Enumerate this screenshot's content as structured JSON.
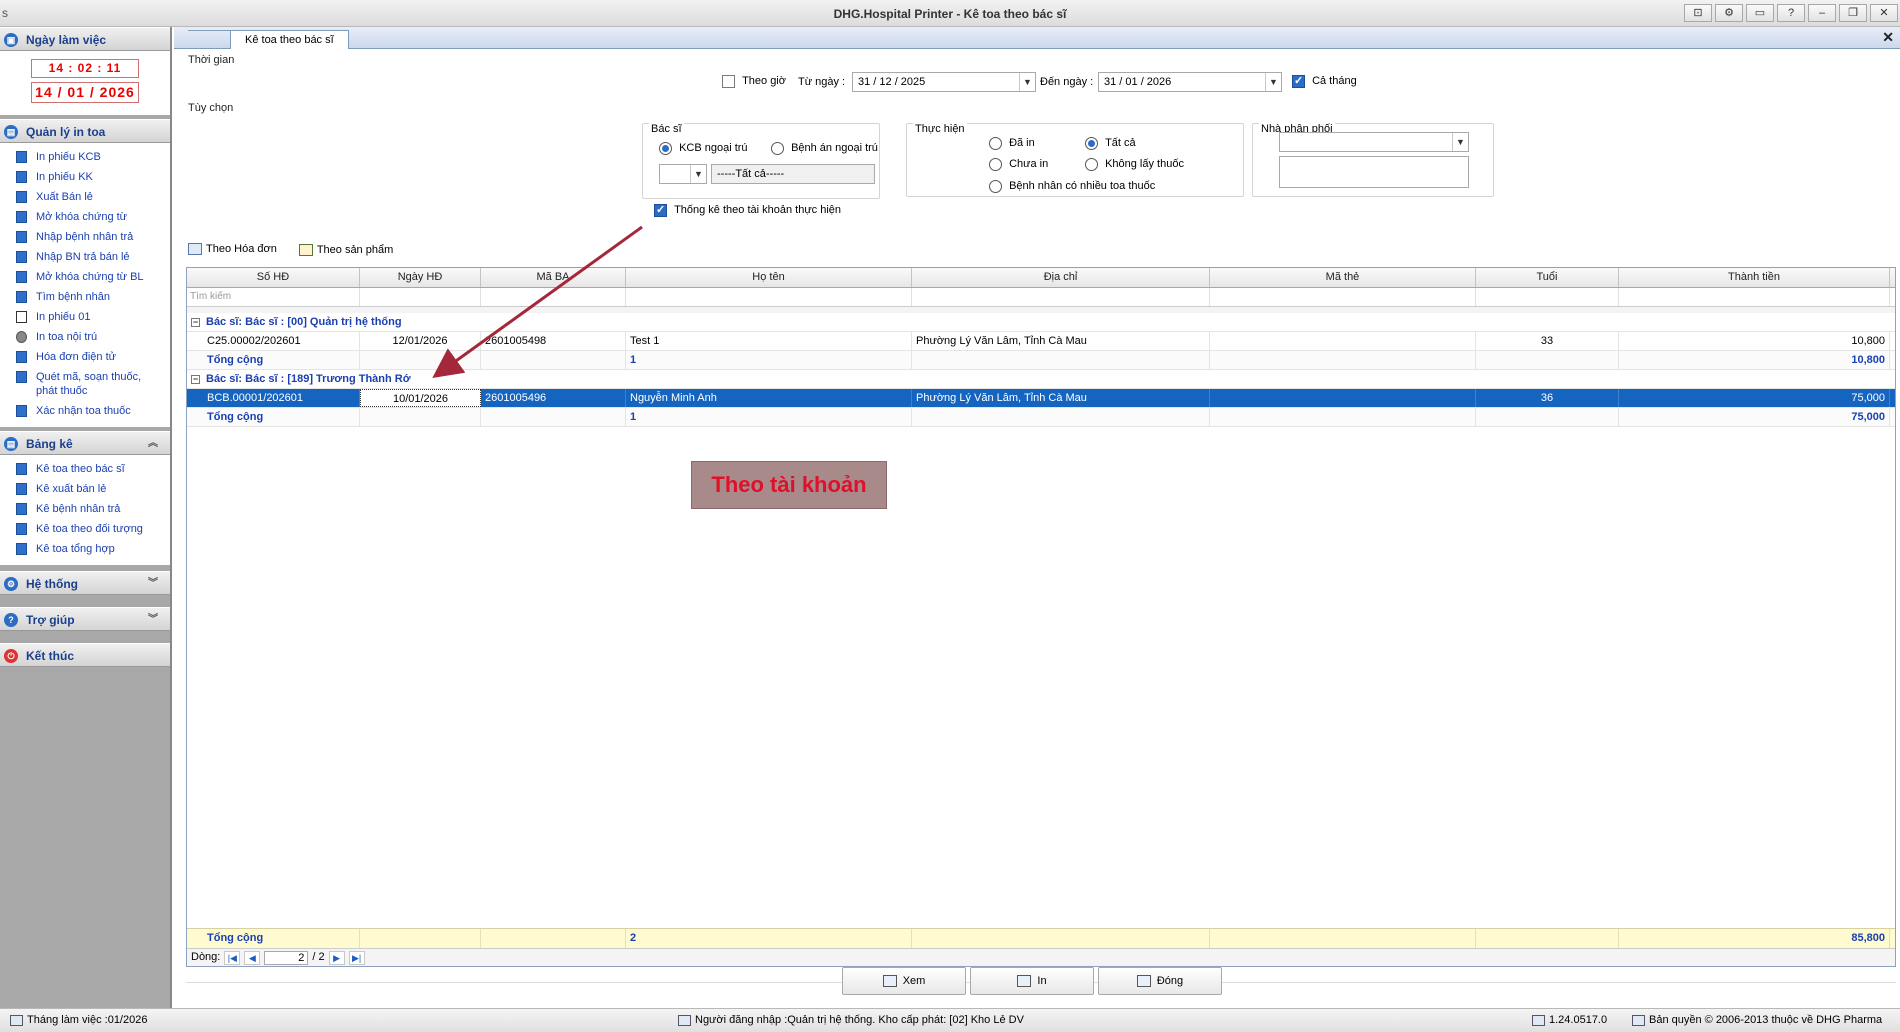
{
  "window": {
    "title": "DHG.Hospital Printer - Kê toa theo bác sĩ",
    "sys_glyph": "s",
    "buttons": [
      "⊡",
      "⚙",
      "▭",
      "?",
      "–",
      "❐",
      "✕"
    ]
  },
  "sidebar": {
    "work_section": {
      "title": "Ngày làm việc",
      "clock": "14 : 02 : 11",
      "date": "14 / 01 / 2026"
    },
    "prescription_section": {
      "title": "Quản lý in toa",
      "items": [
        "In phiếu KCB",
        "In phiếu KK",
        "Xuất Bán lẻ",
        "Mở khóa chứng từ",
        "Nhập bệnh nhân trả",
        "Nhập BN trả bán lẻ",
        "Mở khóa chứng từ BL",
        "Tìm bệnh nhân",
        "In phiếu 01",
        "In toa nội trú",
        "Hóa đơn điện tử",
        "Quét mã, soạn thuốc, phát thuốc",
        "Xác nhận toa thuốc"
      ]
    },
    "report_section": {
      "title": "Bảng kê",
      "items": [
        "Kê toa theo bác sĩ",
        "Kê xuất bán lẻ",
        "Kê bệnh nhân trả",
        "Kê toa theo đối tượng",
        "Kê toa tổng hợp"
      ]
    },
    "system_section": {
      "title": "Hệ thống"
    },
    "help_section": {
      "title": "Trợ giúp"
    },
    "exit_section": {
      "title": "Kết thúc"
    }
  },
  "main": {
    "tab_label": "Kê toa theo bác sĩ",
    "close_glyph": "✕",
    "time_group": {
      "title": "Thời gian",
      "by_hour_label": "Theo giờ",
      "from_label": "Từ ngày :",
      "from_value": "31 / 12 / 2025",
      "to_label": "Đến ngày :",
      "to_value": "31 / 01 / 2026",
      "whole_month_label": "Cả tháng"
    },
    "options_group": {
      "title": "Tùy chọn",
      "doctor": {
        "title": "Bác sĩ",
        "opt1": "KCB ngoại trú",
        "opt2": "Bệnh án ngoại trú",
        "select_all": "-----Tất cả-----"
      },
      "perform": {
        "title": "Thực hiện",
        "printed": "Đã in",
        "all": "Tất cả",
        "not_printed": "Chưa in",
        "no_medicine": "Không lấy thuốc",
        "multi_rx": "Bệnh nhân có nhiều toa thuốc"
      },
      "distributor": {
        "title": "Nhà phân phối"
      },
      "account_stats_label": "Thống kê theo tài khoản thực hiện"
    },
    "view_tabs": {
      "by_invoice": "Theo Hóa đơn",
      "by_product": "Theo sản phẩm"
    },
    "grid": {
      "columns": [
        "Số HĐ",
        "Ngày HĐ",
        "Mã BA",
        "Họ tên",
        "Địa chỉ",
        "Mã thẻ",
        "Tuổi",
        "Thành tiền"
      ],
      "filter_placeholder": "Tìm kiếm",
      "groups": [
        {
          "label": "Bác sĩ:  Bác sĩ : [00] Quản trị hệ thống",
          "rows": [
            {
              "so_hd": "C25.00002/202601",
              "ngay_hd": "12/01/2026",
              "ma_ba": "2601005498",
              "ho_ten": "Test 1",
              "dia_chi": "Phường Lý Văn Lâm, Tỉnh Cà Mau",
              "ma_the": "",
              "tuoi": "33",
              "thanh_tien": "10,800"
            }
          ],
          "total_label": "Tổng cộng",
          "total_count": "1",
          "total_amount": "10,800"
        },
        {
          "label": "Bác sĩ:  Bác sĩ : [189] Trương Thành Rớ",
          "rows": [
            {
              "so_hd": "BCB.00001/202601",
              "ngay_hd": "10/01/2026",
              "ma_ba": "2601005496",
              "ho_ten": "Nguyễn Minh Anh",
              "dia_chi": "Phường Lý Văn Lâm, Tỉnh Cà Mau",
              "ma_the": "",
              "tuoi": "36",
              "thanh_tien": "75,000"
            }
          ],
          "total_label": "Tổng cộng",
          "total_count": "1",
          "total_amount": "75,000"
        }
      ],
      "footer": {
        "label": "Tổng cộng",
        "count": "2",
        "amount": "85,800"
      },
      "nav": {
        "label": "Dòng:",
        "current": "2",
        "total": "/  2"
      }
    },
    "annotation": "Theo tài khoản",
    "annotation_color": "#e0102a",
    "buttons": {
      "view": "Xem",
      "print": "In",
      "close": "Đóng"
    }
  },
  "statusbar": {
    "month": "Tháng làm việc :01/2026",
    "login": "Người đăng nhập :Quản trị hệ thống. Kho cấp phát: [02] Kho Lẻ DV",
    "version": "1.24.0517.0",
    "copyright": "Bản quyền © 2006-2013 thuộc về DHG Pharma"
  }
}
